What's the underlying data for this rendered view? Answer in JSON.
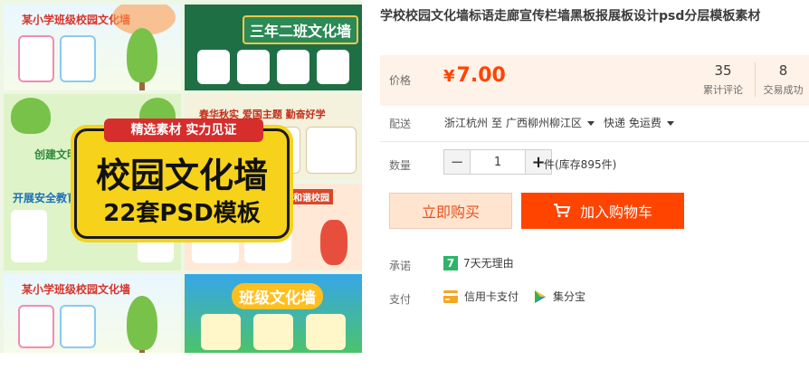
{
  "product_image": {
    "badge_tag": "精选素材 实力见证",
    "badge_main": "校园文化墙",
    "badge_sub": "22套PSD模板",
    "tile_titles": [
      "某小学班级校园文化墙",
      "三年二班文化墙",
      "创建文明",
      "开展安全教育",
      "春华秋实 爱国主题 勤奋好学",
      "和谐校园",
      "某小学班级校园文化墙",
      "班级文化墙"
    ]
  },
  "product": {
    "title": "学校校园文化墙标语走廊宣传栏墙黑板报展板设计psd分层模板素材"
  },
  "price": {
    "label": "价格",
    "currency": "¥",
    "amount": "7.00",
    "reviews_count": "35",
    "reviews_label": "累计评论",
    "sales_count": "8",
    "sales_label": "交易成功"
  },
  "shipping": {
    "label": "配送",
    "from": "浙江杭州",
    "to_word": "至",
    "destination": "广西柳州柳江区",
    "method": "快递 免运费"
  },
  "quantity": {
    "label": "数量",
    "value": "1",
    "minus": "−",
    "plus": "+",
    "stock": "件(库存895件)"
  },
  "actions": {
    "buy_now": "立即购买",
    "add_to_cart": "加入购物车"
  },
  "promise": {
    "label": "承诺",
    "icon_text": "7",
    "text": "7天无理由"
  },
  "payment": {
    "label": "支付",
    "methods": [
      "信用卡支付",
      "集分宝"
    ]
  },
  "colors": {
    "accent": "#ff4400",
    "price_bg": "#fff2e8",
    "badge": "#f6d31a"
  },
  "icons": [
    "cart-icon",
    "seven-day-icon",
    "credit-card-icon",
    "jifenbao-icon",
    "caret-down-icon"
  ]
}
